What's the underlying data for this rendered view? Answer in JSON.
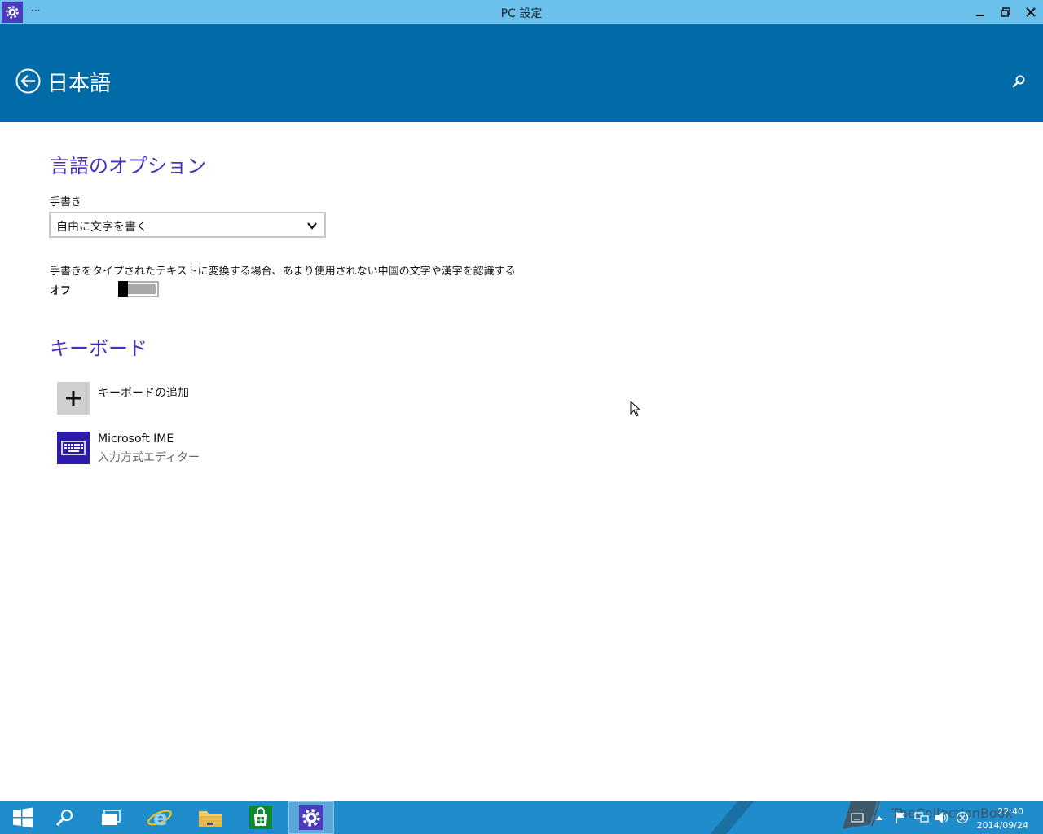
{
  "window": {
    "title": "PC 設定",
    "menu_glyph": "···"
  },
  "header": {
    "title": "日本語"
  },
  "language_options": {
    "heading": "言語のオプション",
    "handwriting_label": "手書き",
    "handwriting_value": "自由に文字を書く",
    "rare_chars_description": "手書きをタイプされたテキストに変換する場合、あまり使用されない中国の文字や漢字を認識する",
    "rare_chars_state": "オフ"
  },
  "keyboard": {
    "heading": "キーボード",
    "add_label": "キーボードの追加",
    "items": [
      {
        "name": "Microsoft IME",
        "type": "入力方式エディター"
      }
    ]
  },
  "taskbar": {
    "watermark": "TheCollectionBook",
    "time": "22:40",
    "date": "2014/09/24"
  },
  "colors": {
    "title_bar": "#6bc0ec",
    "header": "#006ba6",
    "accent_text": "#4a2fbf",
    "taskbar": "#1f8ccc",
    "ime_tile": "#2c1aa8"
  }
}
